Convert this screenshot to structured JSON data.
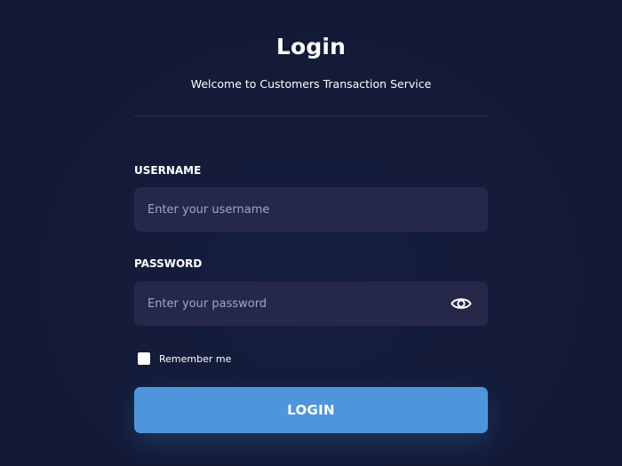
{
  "login": {
    "title": "Login",
    "subtitle": "Welcome to Customers Transaction Service",
    "username": {
      "label": "USERNAME",
      "placeholder": "Enter your username",
      "value": ""
    },
    "password": {
      "label": "PASSWORD",
      "placeholder": "Enter your password",
      "value": "",
      "toggle_icon": "eye-icon"
    },
    "remember": {
      "label": "Remember me",
      "checked": false
    },
    "submit_label": "LOGIN"
  },
  "colors": {
    "background": "#131b38",
    "field_background": "#26284a",
    "divider": "#283055",
    "button": "#4e96dc",
    "text": "#ffffff",
    "placeholder": "#a3a6bf"
  }
}
